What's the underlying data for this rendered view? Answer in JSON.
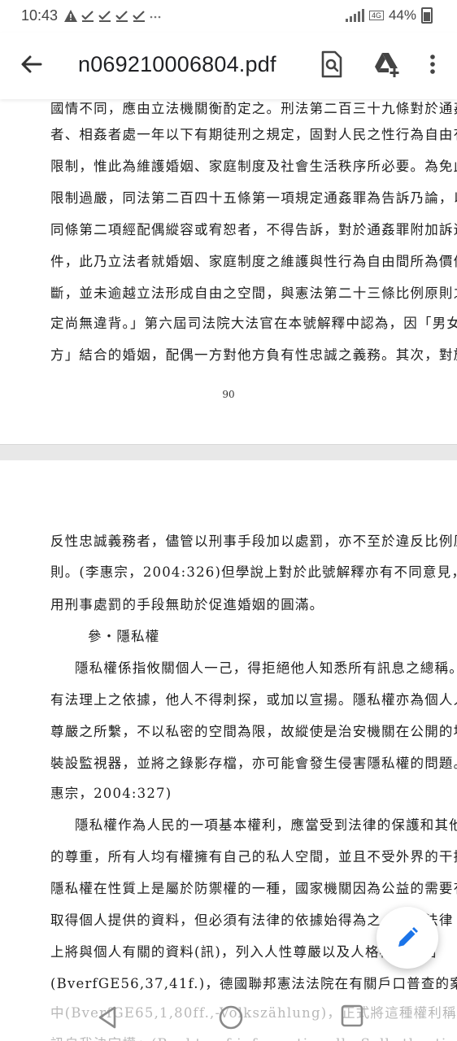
{
  "status_bar": {
    "time": "10:43",
    "notification_icons": [
      "warning-icon",
      "check-icon",
      "check-icon",
      "check-icon",
      "check-icon",
      "more-dots-icon"
    ],
    "net": "4G",
    "battery": "44%"
  },
  "app_bar": {
    "title": "n069210006804.pdf",
    "back_icon": "arrow-left-icon",
    "search_icon": "search-document-icon",
    "drive_icon": "add-to-drive-icon",
    "more_icon": "more-vert-icon"
  },
  "page1": {
    "lines": [
      "國情不同，應由立法機關衡酌定之。刑法第二百三十九條對於通姦",
      "者、相姦者處一年以下有期徒刑之規定，固對人民之性行為自由有所",
      "限制，惟此為維護婚姻、家庭制度及社會生活秩序所必要。為免此項",
      "限制過嚴，同法第二百四十五條第一項規定通姦罪為告訴乃論，以及",
      "同條第二項經配偶縱容或宥恕者，不得告訴，對於通姦罪附加訴追條",
      "件，此乃立法者就婚姻、家庭制度之維護與性行為自由間所為價值判",
      "斷，並未逾越立法形成自由之空間，與憲法第二十三條比例原則之規",
      "定尚無違背。」第六屆司法院大法官在本號解釋中認為，因「男女雙",
      "方」結合的婚姻，配偶一方對他方負有性忠誠之義務。其次，對於違"
    ],
    "page_number": "90"
  },
  "page2": {
    "lines": [
      "反性忠誠義務者，儘管以刑事手段加以處罰，亦不至於違反比例原",
      "則。(李惠宗，2004:326)但學說上對於此號解釋亦有不同意見，認為",
      "用刑事處罰的手段無助於促進婚姻的圓滿。",
      "參・隱私權",
      "隱私權係指攸關個人一己，得拒絕他人知悉所有訊息之總稱。沒",
      "有法理上之依據，他人不得刺探，或加以宣揚。隱私權亦為個人人性",
      "尊嚴之所繫，不以私密的空間為限，故縱使是治安機關在公開的場所",
      "裝設監視器，並將之錄影存檔，亦可能會發生侵害隱私權的問題。(李",
      "惠宗，2004:327)",
      "隱私權作為人民的一項基本權利，應當受到法律的保護和其他人",
      "的尊重，所有人均有權擁有自己的私人空間，並且不受外界的干擾。",
      "隱私權在性質上是屬於防禦權的一種，國家機關因為公益的需要有權",
      "取得個人提供的資料，但必須有法律的依據始得為之。德國法律",
      "上將與個人有關的資料(訊)，列入人性尊嚴以及人格權的範圍",
      "(BverfGE56,37,41f.)，德國聯邦憲法法院在有關戶口普查的案件之",
      "中(BverfGE65,1,80ff.,-Volkszählung)，正式將這種權利稱為「資",
      "訊自我決定權」(Recht auf informationelle Selbstbestimmung)"
    ]
  },
  "fab": {
    "icon": "edit-pencil-icon",
    "color": "#1a73e8"
  },
  "nav_bar": {
    "back_icon": "nav-back-icon",
    "home_icon": "nav-home-icon",
    "recent_icon": "nav-recent-icon"
  }
}
